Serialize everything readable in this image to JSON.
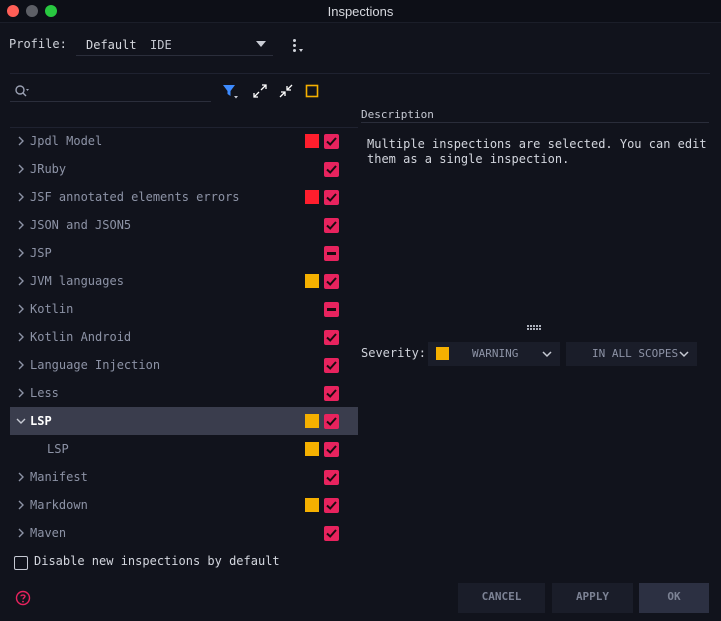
{
  "window": {
    "title": "Inspections"
  },
  "profile": {
    "label": "Profile:",
    "name": "Default",
    "scope": "IDE"
  },
  "search": {
    "placeholder": ""
  },
  "tree": {
    "items": [
      {
        "label": "Jpdl Model",
        "severity": "error",
        "check": "checked",
        "expanded": false,
        "selected": false,
        "child": false
      },
      {
        "label": "JRuby",
        "severity": "none",
        "check": "checked",
        "expanded": false,
        "selected": false,
        "child": false
      },
      {
        "label": "JSF annotated elements errors",
        "severity": "error",
        "check": "checked",
        "expanded": false,
        "selected": false,
        "child": false
      },
      {
        "label": "JSON and JSON5",
        "severity": "none",
        "check": "checked",
        "expanded": false,
        "selected": false,
        "child": false
      },
      {
        "label": "JSP",
        "severity": "none",
        "check": "indeterminate",
        "expanded": false,
        "selected": false,
        "child": false
      },
      {
        "label": "JVM languages",
        "severity": "warning",
        "check": "checked",
        "expanded": false,
        "selected": false,
        "child": false
      },
      {
        "label": "Kotlin",
        "severity": "none",
        "check": "indeterminate",
        "expanded": false,
        "selected": false,
        "child": false
      },
      {
        "label": "Kotlin Android",
        "severity": "none",
        "check": "checked",
        "expanded": false,
        "selected": false,
        "child": false
      },
      {
        "label": "Language Injection",
        "severity": "none",
        "check": "checked",
        "expanded": false,
        "selected": false,
        "child": false
      },
      {
        "label": "Less",
        "severity": "none",
        "check": "checked",
        "expanded": false,
        "selected": false,
        "child": false
      },
      {
        "label": "LSP",
        "severity": "warning",
        "check": "checked",
        "expanded": true,
        "selected": true,
        "child": false
      },
      {
        "label": "LSP",
        "severity": "warning",
        "check": "checked",
        "expanded": false,
        "selected": false,
        "child": true
      },
      {
        "label": "Manifest",
        "severity": "none",
        "check": "checked",
        "expanded": false,
        "selected": false,
        "child": false
      },
      {
        "label": "Markdown",
        "severity": "warning",
        "check": "checked",
        "expanded": false,
        "selected": false,
        "child": false
      },
      {
        "label": "Maven",
        "severity": "none",
        "check": "checked",
        "expanded": false,
        "selected": false,
        "child": false
      }
    ]
  },
  "description": {
    "title": "Description",
    "text": "Multiple inspections are selected. You can edit them as a single inspection."
  },
  "severity": {
    "label": "Severity:",
    "value": "WARNING",
    "scope": "IN ALL SCOPES"
  },
  "options": {
    "disable_new_label": "Disable new inspections by default"
  },
  "buttons": {
    "cancel": "CANCEL",
    "apply": "APPLY",
    "ok": "OK"
  },
  "colors": {
    "error": "#ff1e2d",
    "warning": "#f5b000",
    "checkbox": "#e8235e",
    "accent": "#3d8bff",
    "background": "#11131c"
  }
}
